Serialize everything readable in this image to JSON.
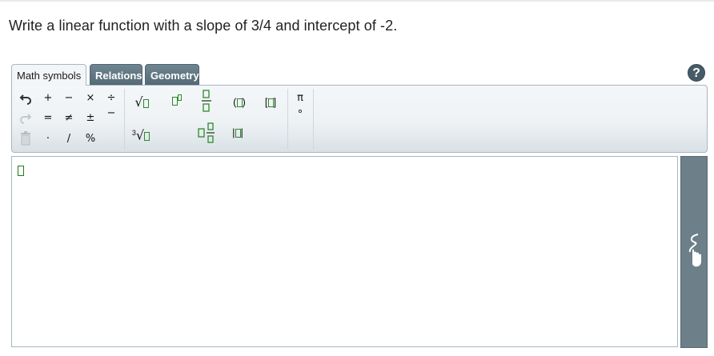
{
  "question": "Write a linear function with a slope of 3/4 and intercept of -2.",
  "tabs": [
    {
      "label": "Math symbols"
    },
    {
      "label": "Relations"
    },
    {
      "label": "Geometry"
    }
  ],
  "help_label": "?",
  "toolbar": {
    "plus": "+",
    "minus": "−",
    "times": "×",
    "divide": "÷",
    "equals": "=",
    "notequal": "≠",
    "plusminus": "±",
    "fracbar": "−",
    "dot": "·",
    "slash": "/",
    "percent": "%",
    "sqrt": "√",
    "cuberoot_index": "3",
    "cuberoot": "√",
    "paren_l": "(",
    "paren_r": ")",
    "bracket_l": "[",
    "bracket_r": "]",
    "abs_l": "|",
    "abs_r": "|",
    "pi": "π",
    "degree": "°"
  },
  "icons": [
    "undo-icon",
    "redo-icon",
    "trash-icon",
    "handwriting-icon",
    "help-icon"
  ]
}
